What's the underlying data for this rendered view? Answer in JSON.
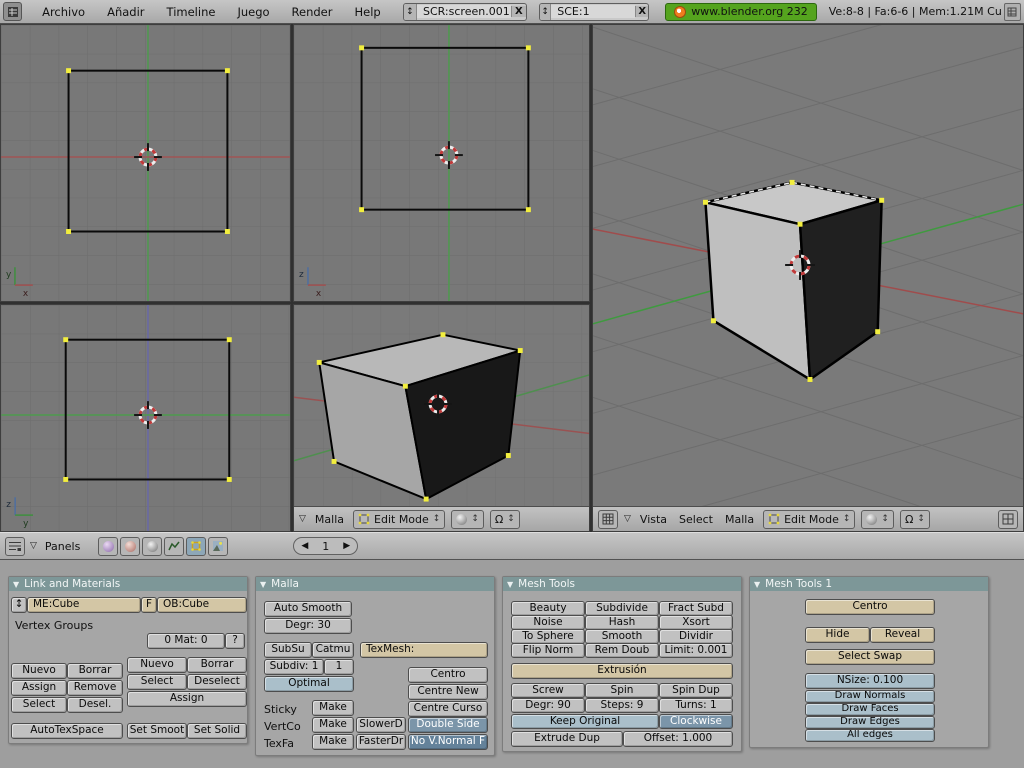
{
  "topbar": {
    "menus": [
      "Archivo",
      "Añadir",
      "Timeline",
      "Juego",
      "Render",
      "Help"
    ],
    "screen_selector": {
      "value": "SCR:screen.001",
      "close": "X"
    },
    "scene_selector": {
      "value": "SCE:1",
      "close": "X"
    },
    "version_button": "www.blender.org 232",
    "stats": "Ve:8-8 | Fa:6-6 | Mem:1.21M Cu"
  },
  "viewport": {
    "axis": {
      "tl": {
        "up": "y",
        "right": "x"
      },
      "tm": {
        "up": "z",
        "right": "x"
      },
      "bl": {
        "up": "z",
        "right": "y"
      }
    },
    "mesh_menu": "Malla",
    "view_menu": "Vista",
    "select_menu": "Select",
    "mode": "Edit Mode"
  },
  "buttons_header": {
    "panels_label": "Panels",
    "page": "1"
  },
  "panels": {
    "link": {
      "title": "Link and Materials",
      "me_field": "ME:Cube",
      "f_button": "F",
      "ob_field": "OB:Cube",
      "vertex_groups_label": "Vertex Groups",
      "mat_counter": "0 Mat: 0",
      "help_button": "?",
      "vg_rows": [
        [
          "Nuevo",
          "Borrar"
        ],
        [
          "Assign",
          "Remove"
        ],
        [
          "Select",
          "Desel."
        ]
      ],
      "autotexspace": "AutoTexSpace",
      "mat_rows": [
        [
          "Nuevo",
          "Borrar"
        ],
        [
          "Select",
          "Deselect"
        ]
      ],
      "assign_button": "Assign",
      "set_smooth": "Set Smoot",
      "set_solid": "Set Solid"
    },
    "malla": {
      "title": "Malla",
      "auto_smooth": "Auto Smooth",
      "degr": "Degr: 30",
      "subsurf": "SubSu",
      "subsurf_type": "Catmu",
      "texmesh_field": "TexMesh:",
      "subdiv": "Subdiv: 1",
      "subdiv_render": "1",
      "optimal": "Optimal",
      "sticky_label": "Sticky",
      "vertcol_label": "VertCo",
      "texface_label": "TexFa",
      "make_button": "Make",
      "centro": "Centro",
      "centre_new": "Centre New",
      "centre_cursor": "Centre Curso",
      "slower_draw": "SlowerD",
      "faster_draw": "FasterDr",
      "double_side": "Double Side",
      "no_vnormal_flip": "No V.Normal F"
    },
    "mesh_tools": {
      "title": "Mesh Tools",
      "rows": [
        [
          "Beauty",
          "Subdivide",
          "Fract Subd"
        ],
        [
          "Noise",
          "Hash",
          "Xsort"
        ],
        [
          "To Sphere",
          "Smooth",
          "Dividir"
        ],
        [
          "Flip Norm",
          "Rem Doub",
          "Limit: 0.001"
        ]
      ],
      "extrude": "Extrusión",
      "spin_row": [
        "Screw",
        "Spin",
        "Spin Dup"
      ],
      "value_row": [
        "Degr: 90",
        "Steps: 9",
        "Turns: 1"
      ],
      "keep_original": "Keep Original",
      "clockwise": "Clockwise",
      "extrude_dup": "Extrude Dup",
      "offset": "Offset: 1.000"
    },
    "mesh_tools1": {
      "title": "Mesh Tools 1",
      "centro": "Centro",
      "hide": "Hide",
      "reveal": "Reveal",
      "select_swap": "Select Swap",
      "nsize": "NSize: 0.100",
      "toggles": [
        "Draw Normals",
        "Draw Faces",
        "Draw Edges",
        "All edges"
      ]
    }
  },
  "icons": {
    "updown": "↕",
    "dropdown_triangle": "▽",
    "panel_triangle": "▼",
    "page_prev": "◀",
    "page_next": "▶",
    "omega": "Ω"
  },
  "colors": {
    "version_green": "#55a41e",
    "panel_header": "#7d9798",
    "active_toggle": "#7b95a9",
    "field_tan": "#d3c6a5",
    "toggle_blue": "#aabfca"
  }
}
